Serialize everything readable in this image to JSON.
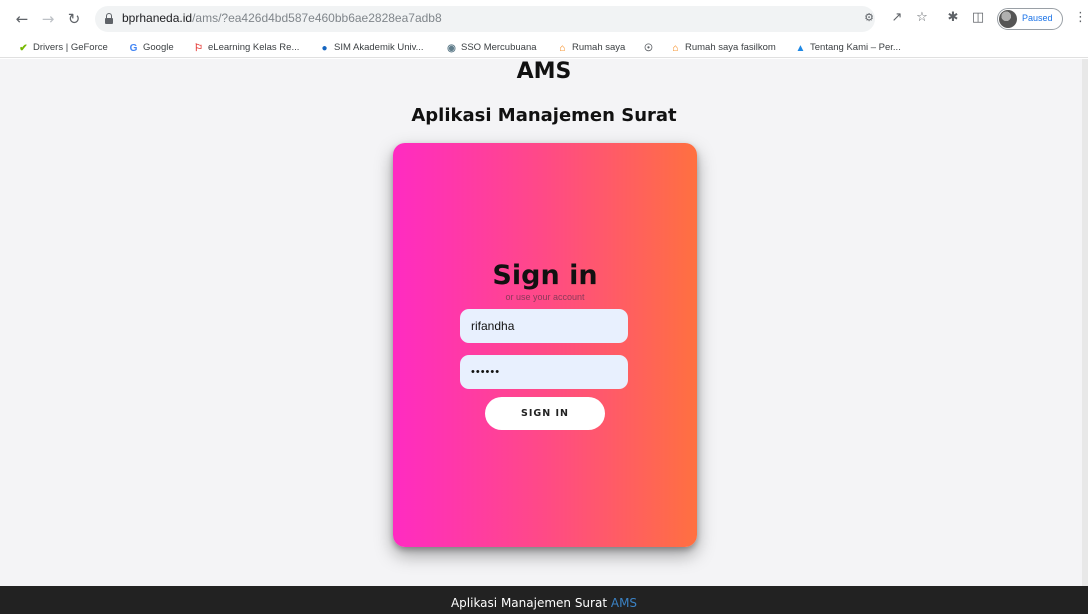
{
  "browser": {
    "url_host": "bprhaneda.id",
    "url_path": "/ams/?ea426d4bd587e460bb6ae2828ea7adb8",
    "profile_status": "Paused",
    "icons": {
      "back": "back-arrow-icon",
      "forward": "forward-arrow-icon",
      "reload": "reload-icon",
      "lock": "lock-icon",
      "key": "key-icon",
      "share": "share-icon",
      "star": "star-icon",
      "extensions": "puzzle-icon",
      "sidepanel": "side-panel-icon",
      "menu": "kebab-menu-icon"
    }
  },
  "bookmarks": [
    {
      "label": "Drivers | GeForce",
      "icon": "geforce-icon",
      "color": "#76b900"
    },
    {
      "label": "Google",
      "icon": "google-icon",
      "color": "#4285f4"
    },
    {
      "label": "eLearning Kelas Re...",
      "icon": "elearning-icon",
      "color": "#e53935"
    },
    {
      "label": "SIM Akademik Univ...",
      "icon": "sim-icon",
      "color": "#1565c0"
    },
    {
      "label": "SSO Mercubuana",
      "icon": "sso-icon",
      "color": "#607d8b"
    },
    {
      "label": "Rumah saya",
      "icon": "home-icon",
      "color": "#f57c00"
    },
    {
      "label": "",
      "icon": "globe-icon",
      "color": "#5f6368"
    },
    {
      "label": "Rumah saya fasilkom",
      "icon": "home-icon",
      "color": "#f57c00"
    },
    {
      "label": "Tentang Kami – Per...",
      "icon": "bank-icon",
      "color": "#1e88e5"
    }
  ],
  "page": {
    "title": "AMS",
    "subtitle": "Aplikasi Manajemen Surat"
  },
  "login": {
    "heading": "Sign in",
    "subheading": "or use your account",
    "username_value": "rifandha",
    "password_value": "••••••",
    "button_label": "SIGN IN",
    "gradient_start": "#ff2bc2",
    "gradient_end": "#ff7040"
  },
  "footer": {
    "text": "Aplikasi Manajemen Surat",
    "accent": "AMS",
    "accent_color": "#3b82c4"
  }
}
